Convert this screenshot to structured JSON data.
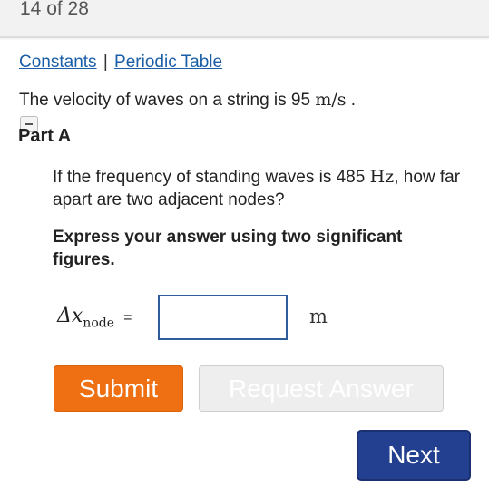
{
  "header": {
    "counter": "14 of 28"
  },
  "links": {
    "constants": "Constants",
    "separator": "|",
    "periodic_table": "Periodic Table"
  },
  "problem": {
    "intro_text": "The velocity of waves on a string is 95",
    "intro_unit": "m/s",
    "intro_end": "."
  },
  "part": {
    "title": "Part A",
    "question_text": "If the frequency of standing waves is 485",
    "question_unit": "Hz",
    "question_rest": ", how far apart are two adjacent nodes?",
    "instruction": "Express your answer using two significant figures."
  },
  "answer": {
    "label_symbol": "Δx",
    "label_subscript": "node",
    "label_equals": "=",
    "value": "",
    "unit": "m"
  },
  "buttons": {
    "submit": "Submit",
    "request_answer": "Request Answer",
    "next": "Next"
  },
  "colors": {
    "submit_bg": "#ee7012",
    "next_bg": "#233f8f",
    "link": "#1a5ea8",
    "input_border": "#2f5d9a"
  }
}
